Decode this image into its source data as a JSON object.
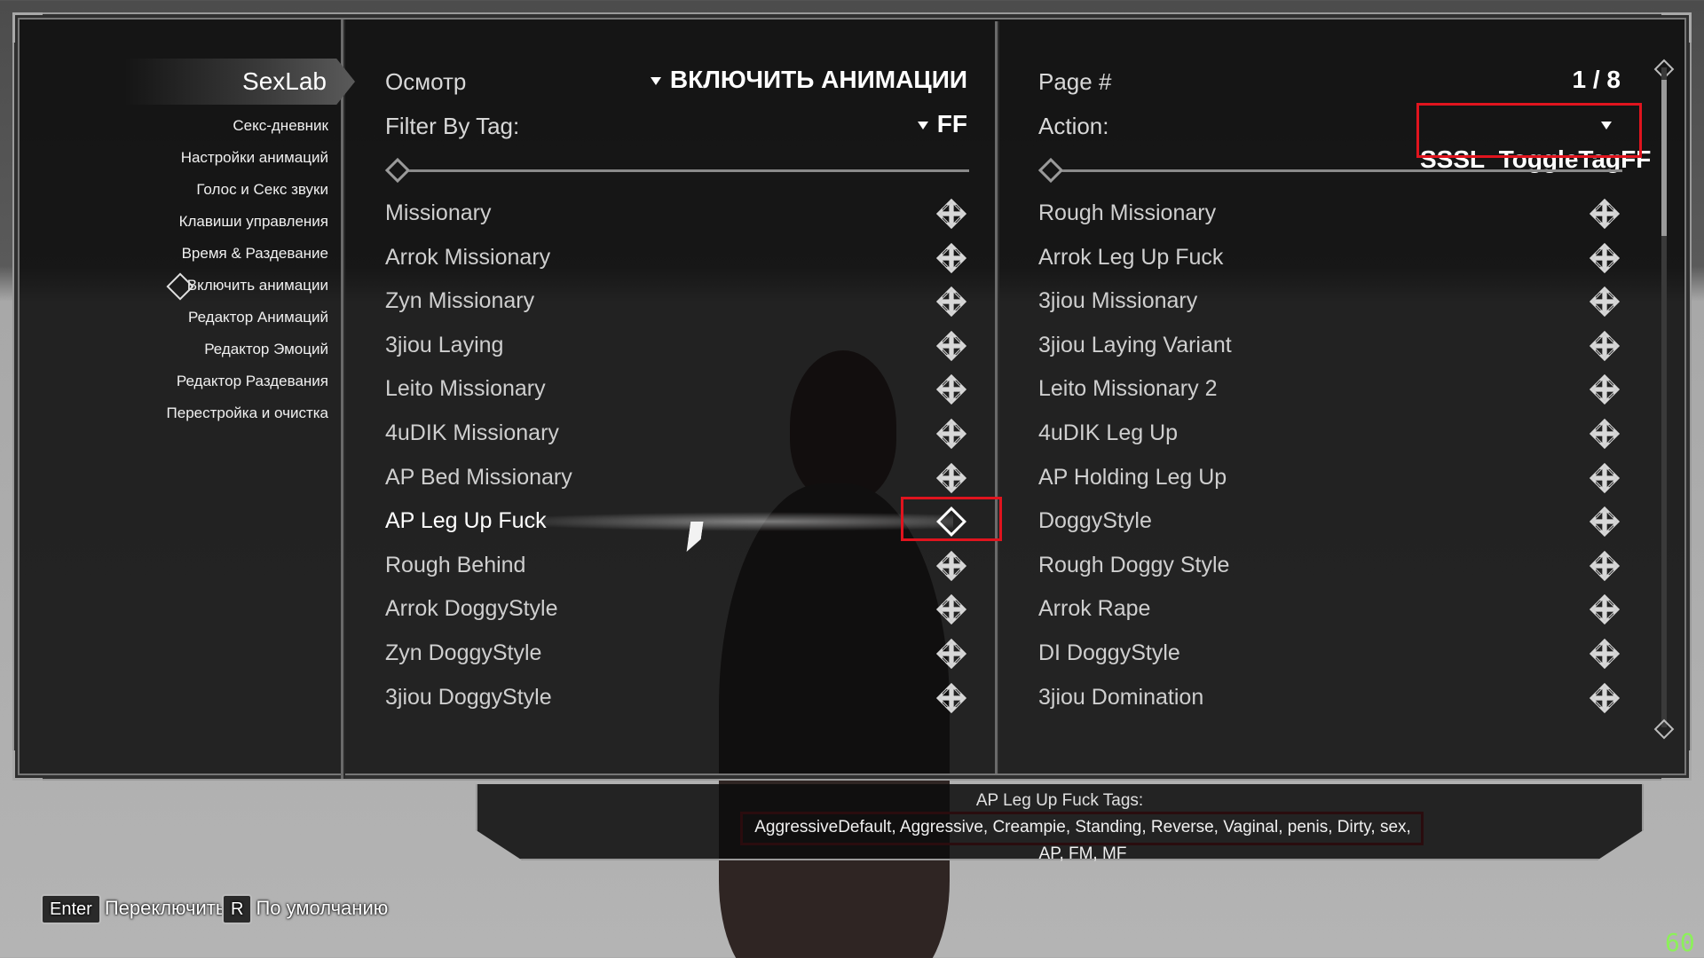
{
  "nav": {
    "title": "SexLab",
    "items": [
      {
        "label": "Секс-дневник"
      },
      {
        "label": "Настройки анимаций"
      },
      {
        "label": "Голос и Секс звуки"
      },
      {
        "label": "Клавиши управления"
      },
      {
        "label": "Время & Раздевание"
      },
      {
        "label": "Включить анимации",
        "active": true
      },
      {
        "label": "Редактор Анимаций"
      },
      {
        "label": "Редактор Эмоций"
      },
      {
        "label": "Редактор Раздевания"
      },
      {
        "label": "Перестройка и очистка"
      }
    ]
  },
  "left": {
    "view_label": "Осмотр",
    "view_value": "ВКЛЮЧИТЬ АНИМАЦИИ",
    "filter_label": "Filter By Tag:",
    "filter_value": "FF",
    "items": [
      {
        "label": "Missionary",
        "checked": true
      },
      {
        "label": "Arrok Missionary",
        "checked": true
      },
      {
        "label": "Zyn Missionary",
        "checked": true
      },
      {
        "label": "3jiou Laying",
        "checked": true
      },
      {
        "label": "Leito Missionary",
        "checked": true
      },
      {
        "label": "4uDIK Missionary",
        "checked": true
      },
      {
        "label": "AP Bed Missionary",
        "checked": true
      },
      {
        "label": "AP Leg Up Fuck",
        "checked": false,
        "selected": true
      },
      {
        "label": "Rough Behind",
        "checked": true
      },
      {
        "label": "Arrok DoggyStyle",
        "checked": true
      },
      {
        "label": "Zyn DoggyStyle",
        "checked": true
      },
      {
        "label": "3jiou DoggyStyle",
        "checked": true
      }
    ]
  },
  "right": {
    "page_label": "Page #",
    "page_value": "1 / 8",
    "action_label": "Action:",
    "action_value": "SSSL_ToggleTagFF",
    "items": [
      {
        "label": "Rough Missionary",
        "checked": true
      },
      {
        "label": "Arrok Leg Up Fuck",
        "checked": true
      },
      {
        "label": "3jiou Missionary",
        "checked": true
      },
      {
        "label": "3jiou Laying Variant",
        "checked": true
      },
      {
        "label": "Leito Missionary 2",
        "checked": true
      },
      {
        "label": "4uDIK Leg Up",
        "checked": true
      },
      {
        "label": "AP Holding Leg Up",
        "checked": true
      },
      {
        "label": "DoggyStyle",
        "checked": true
      },
      {
        "label": "Rough Doggy Style",
        "checked": true
      },
      {
        "label": "Arrok Rape",
        "checked": true
      },
      {
        "label": "DI DoggyStyle",
        "checked": true
      },
      {
        "label": "3jiou Domination",
        "checked": true
      }
    ]
  },
  "info": {
    "title": "AP Leg Up Fuck Tags:",
    "tags": "AggressiveDefault, Aggressive, Creampie, Standing, Reverse, Vaginal, penis, Dirty, sex, AP, FM, MF"
  },
  "hotkeys": [
    {
      "key": "Enter",
      "label": "Переключить"
    },
    {
      "key": "R",
      "label": "По умолчанию"
    }
  ],
  "fps": "60",
  "colors": {
    "highlight": "#e0141e",
    "fps": "#8cf05a"
  }
}
